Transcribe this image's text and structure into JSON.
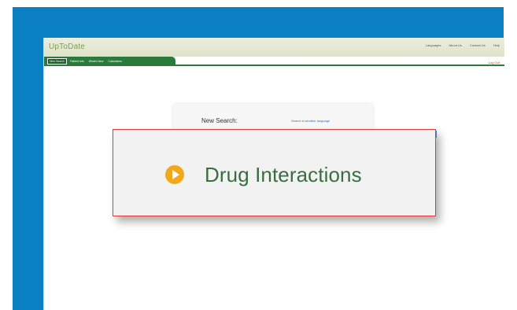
{
  "app": {
    "logo": "UpToDate",
    "top_links": [
      "Languages",
      "About Us",
      "Contact Us",
      "Help"
    ],
    "logout": "Log Out"
  },
  "nav": {
    "tabs": [
      "New Search",
      "Patient Info",
      "What's New",
      "Calculators"
    ]
  },
  "search": {
    "title": "New Search:",
    "hint_prefix": "Search in",
    "hint_link": "another language"
  },
  "highlight": {
    "label": "Drug Interactions",
    "icon": "play-circle-icon",
    "icon_color": "#f2a81c",
    "border_color": "#e03a3a"
  }
}
